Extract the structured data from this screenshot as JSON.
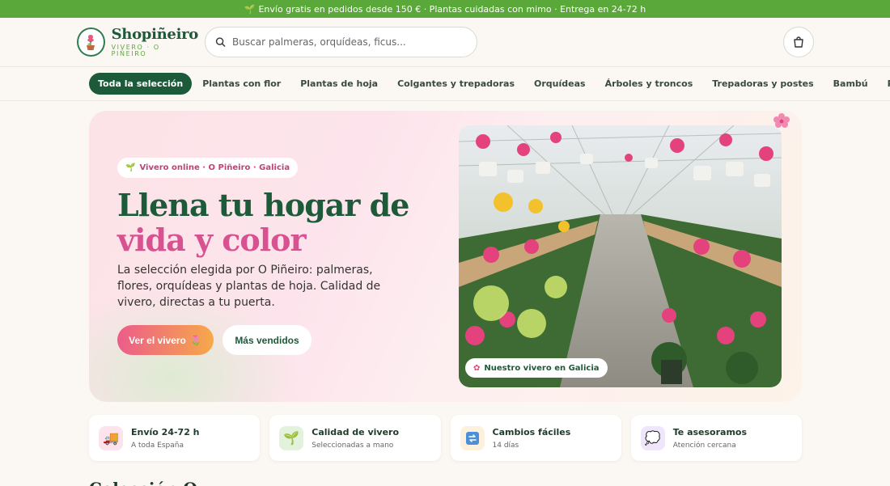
{
  "promo": {
    "icon": "sprout-icon",
    "text": "Envío gratis en pedidos desde 150 € · Plantas cuidadas con mimo · Entrega en 24-72 h"
  },
  "header": {
    "brand_name": "Shopiñeiro",
    "brand_tagline": "VIVERO · O PIÑEIRO",
    "search_placeholder": "Buscar palmeras, orquídeas, ficus...",
    "cart_icon": "shopping-bag-icon"
  },
  "nav": {
    "items": [
      {
        "label": "Toda la selección",
        "active": true
      },
      {
        "label": "Plantas con flor"
      },
      {
        "label": "Plantas de hoja"
      },
      {
        "label": "Colgantes y trepadoras"
      },
      {
        "label": "Orquídeas"
      },
      {
        "label": "Árboles y troncos"
      },
      {
        "label": "Trepadoras y postes"
      },
      {
        "label": "Bambú"
      },
      {
        "label": "Palmeras"
      }
    ]
  },
  "hero": {
    "pill": "Vivero online · O Piñeiro · Galicia",
    "title_line1": "Llena tu hogar de",
    "title_line2": "vida y color",
    "lead": "La selección elegida por O Piñeiro: palmeras, flores, orquídeas y plantas de hoja. Calidad de vivero, directas a tu puerta.",
    "cta_primary": "Ver el vivero",
    "cta_secondary": "Más vendidos",
    "photo_badge": "Nuestro vivero en Galicia"
  },
  "features": [
    {
      "title": "Envío 24-72 h",
      "subtitle": "A toda España",
      "icon": "truck-icon",
      "color": "#fde3ec"
    },
    {
      "title": "Calidad de vivero",
      "subtitle": "Seleccionadas a mano",
      "icon": "seedling-icon",
      "color": "#e3f2dd"
    },
    {
      "title": "Cambios fáciles",
      "subtitle": "14 días",
      "icon": "exchange-icon",
      "color": "#fdf0dc"
    },
    {
      "title": "Te asesoramos",
      "subtitle": "Atención cercana",
      "icon": "chat-icon",
      "color": "#efe6fb"
    }
  ],
  "next_section_title": "Colección O Piñeiro",
  "colors": {
    "brand_green": "#1d5a3a",
    "accent_pink": "#d85190",
    "promo_green": "#5aa83a"
  }
}
